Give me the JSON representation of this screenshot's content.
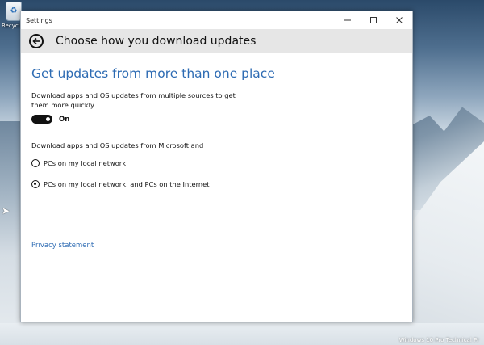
{
  "desktop": {
    "recycle_label": "Recycle Bin",
    "watermark": "Windows 10 Pro Technical Pr"
  },
  "window": {
    "title": "Settings",
    "minimize_icon": "minimize-icon",
    "maximize_icon": "maximize-icon",
    "close_icon": "close-icon"
  },
  "header": {
    "back_icon": "back-arrow-icon",
    "title": "Choose how you download updates"
  },
  "main": {
    "section_heading": "Get updates from more than one place",
    "description": "Download apps and OS updates from multiple sources to get them more quickly.",
    "toggle": {
      "state": "On"
    },
    "source_description": "Download apps and OS updates from Microsoft and",
    "options": [
      {
        "label": "PCs on my local network",
        "selected": false
      },
      {
        "label": "PCs on my local network, and PCs on the Internet",
        "selected": true
      }
    ],
    "privacy_link": "Privacy statement"
  },
  "colors": {
    "accent": "#2d6bb3",
    "header_bg": "#e6e6e6"
  }
}
